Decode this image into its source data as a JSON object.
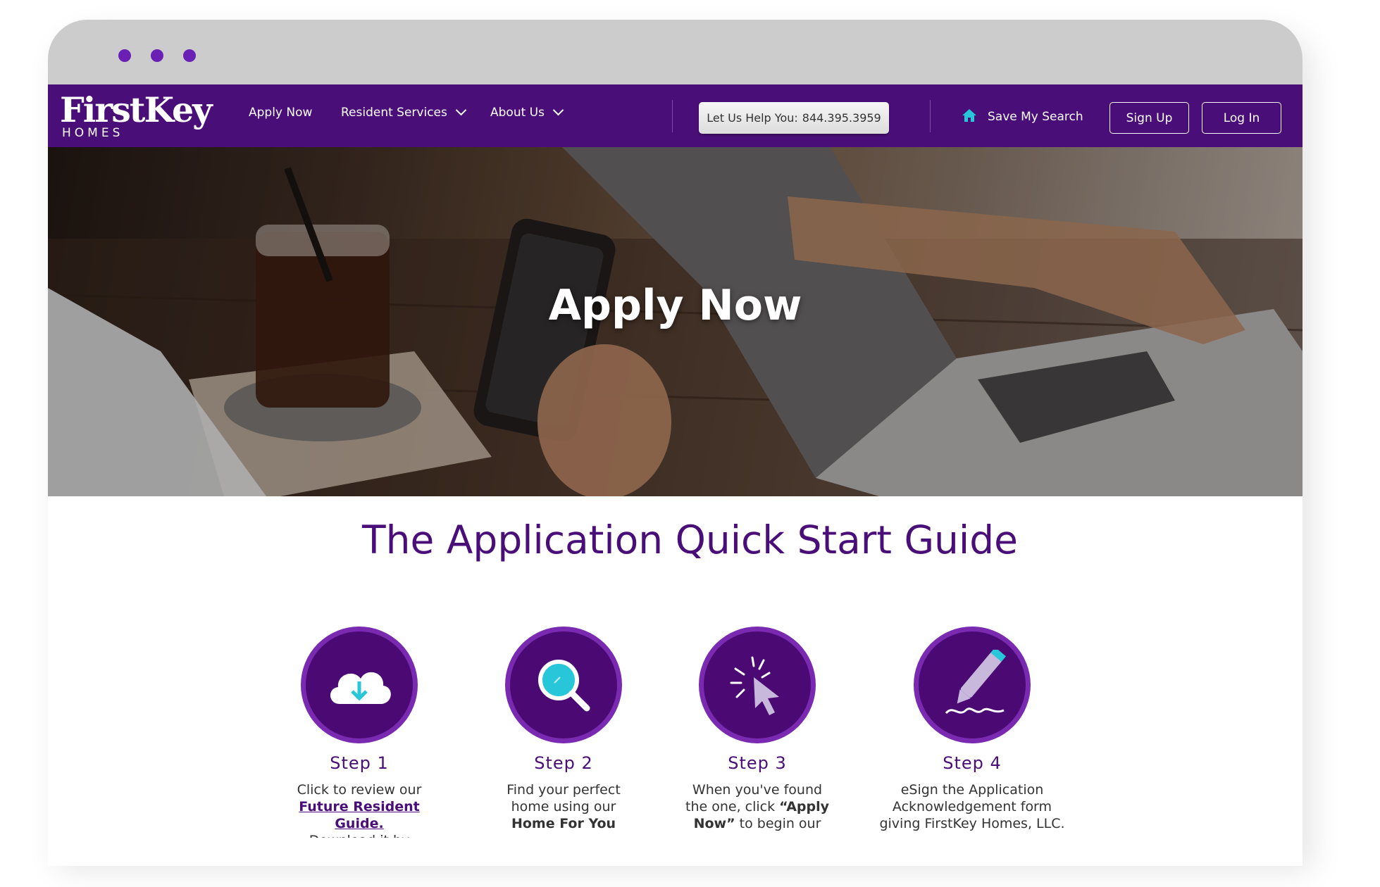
{
  "nav": {
    "logo_main": "FirstKey",
    "logo_sub": "HOMES",
    "menu": [
      {
        "label": "Apply Now"
      },
      {
        "label": "Resident Services"
      },
      {
        "label": "About Us"
      }
    ],
    "help_label": "Let Us Help You:",
    "help_phone": "844.395.3959",
    "save_search": "Save My Search",
    "sign_up": "Sign Up",
    "log_in": "Log In"
  },
  "hero": {
    "title": "Apply Now"
  },
  "guide": {
    "title": "The Application Quick Start Guide",
    "steps": [
      {
        "title": "Step 1",
        "line1": "Click to review our",
        "link": "Future Resident Guide.",
        "line2": "Download it by",
        "icon": "cloud-download-icon"
      },
      {
        "title": "Step 2",
        "line1": "Find your perfect",
        "line2": "home using our",
        "bold": "Home For You",
        "icon": "magnifier-icon"
      },
      {
        "title": "Step 3",
        "line1": "When you've found",
        "line2": "the one, click",
        "bold1": "“Apply",
        "bold2": "Now”",
        "line3": "to begin our",
        "icon": "cursor-click-icon"
      },
      {
        "title": "Step 4",
        "line1": "eSign the Application",
        "line2": "Acknowledgement form",
        "line3": "giving FirstKey Homes, LLC.",
        "icon": "pen-sign-icon"
      }
    ]
  },
  "colors": {
    "brand_purple": "#4a0e78",
    "accent_purple": "#7a2ab0",
    "accent_teal": "#27c6d9"
  }
}
